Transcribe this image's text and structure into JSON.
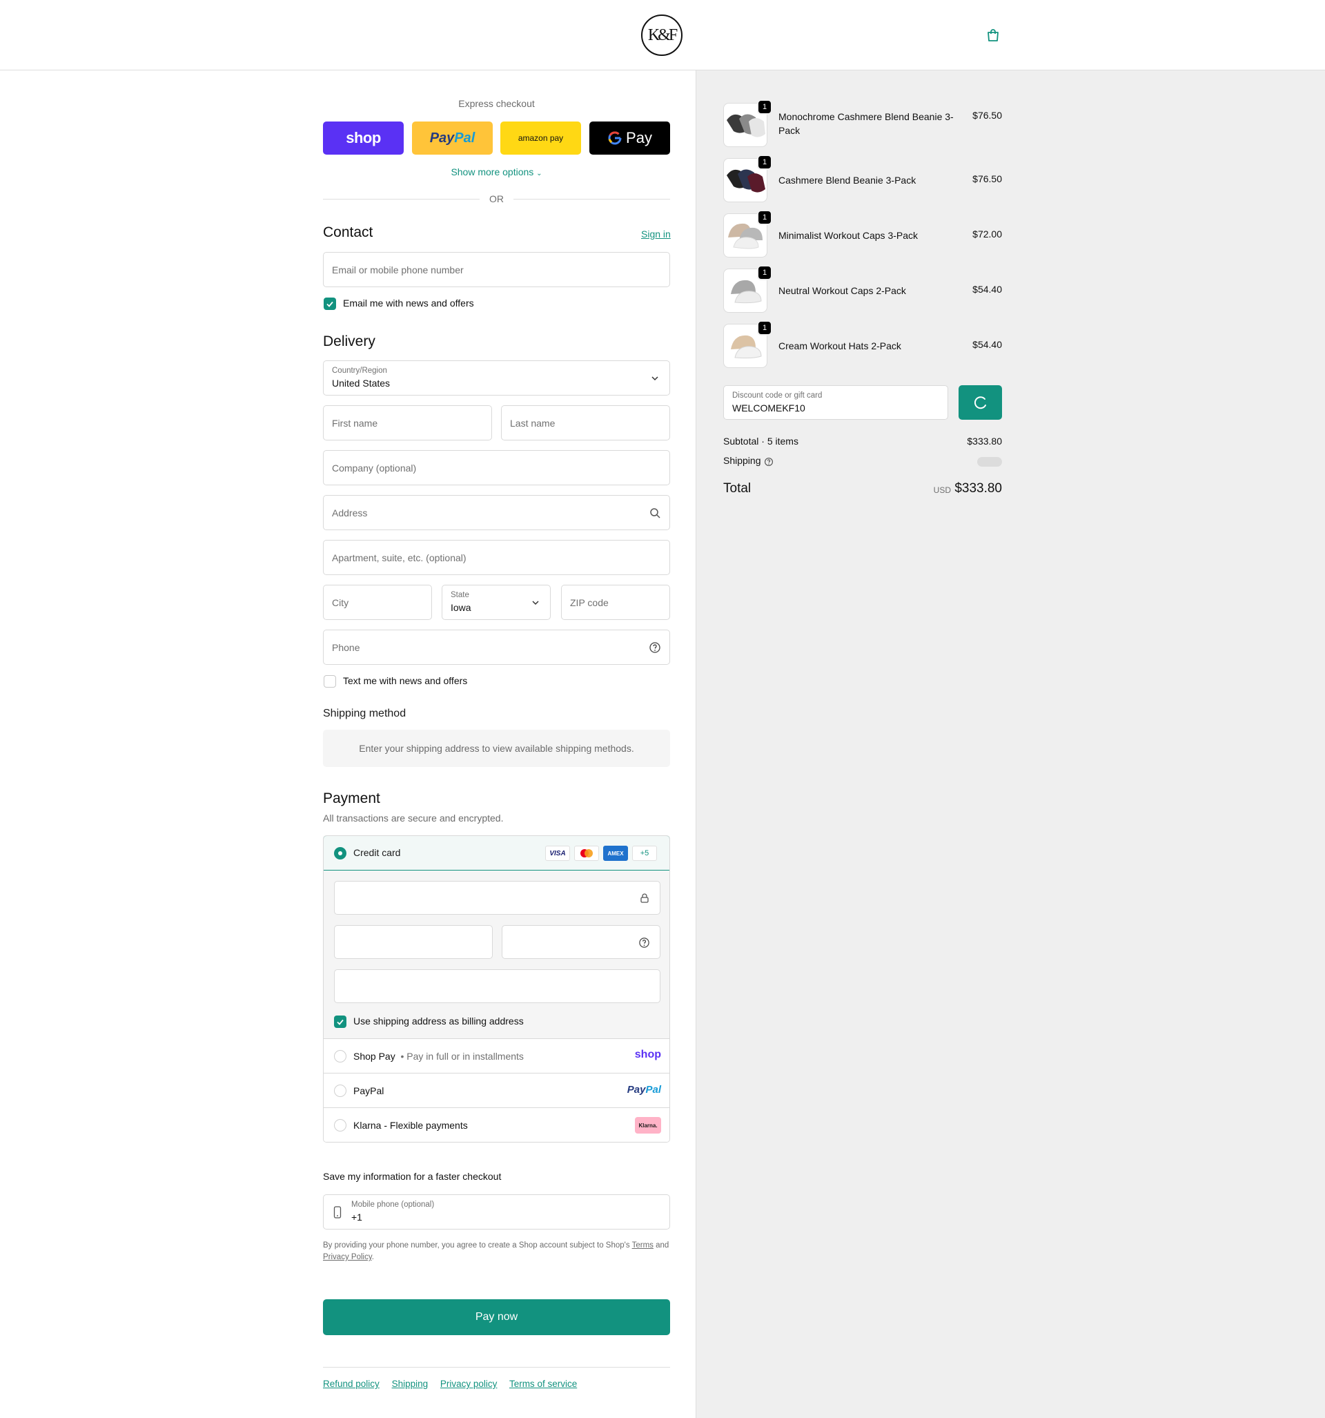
{
  "header": {
    "logo_text": "K&F"
  },
  "express": {
    "title": "Express checkout",
    "buttons": {
      "shop": "shop",
      "paypal_a": "Pay",
      "paypal_b": "Pal",
      "amazon": "amazon pay",
      "gpay": "Pay"
    },
    "show_more": "Show more options",
    "or": "OR"
  },
  "contact": {
    "title": "Contact",
    "sign_in": "Sign in",
    "email_placeholder": "Email or mobile phone number",
    "news_label": "Email me with news and offers"
  },
  "delivery": {
    "title": "Delivery",
    "country_label": "Country/Region",
    "country_value": "United States",
    "first_name": "First name",
    "last_name": "Last name",
    "company": "Company (optional)",
    "address": "Address",
    "apartment": "Apartment, suite, etc. (optional)",
    "city": "City",
    "state_label": "State",
    "state_value": "Iowa",
    "zip": "ZIP code",
    "phone": "Phone",
    "text_label": "Text me with news and offers"
  },
  "shipping_method": {
    "title": "Shipping method",
    "message": "Enter your shipping address to view available shipping methods."
  },
  "payment": {
    "title": "Payment",
    "subtitle": "All transactions are secure and encrypted.",
    "credit_card": "Credit card",
    "badges": {
      "visa": "VISA",
      "amex": "AMEX",
      "more": "+5"
    },
    "billing_label": "Use shipping address as billing address",
    "shop_pay": "Shop Pay",
    "shop_pay_sub": "Pay in full or in installments",
    "shop_pay_logo": "shop",
    "paypal": "PayPal",
    "paypal_logo_a": "Pay",
    "paypal_logo_b": "Pal",
    "klarna": "Klarna - Flexible payments",
    "klarna_logo": "Klarna."
  },
  "save_info": {
    "title": "Save my information for a faster checkout",
    "mobile_label": "Mobile phone (optional)",
    "mobile_value": "+1",
    "legal_1": "By providing your phone number, you agree to create a Shop account subject to Shop's",
    "terms": "Terms",
    "legal_and": "and",
    "privacy": "Privacy Policy",
    "legal_end": "."
  },
  "pay_now": "Pay now",
  "footer": {
    "refund": "Refund policy",
    "shipping": "Shipping",
    "privacy": "Privacy policy",
    "terms": "Terms of service"
  },
  "summary": {
    "items": [
      {
        "name": "Monochrome Cashmere Blend Beanie 3-Pack",
        "price": "$76.50",
        "qty": "1"
      },
      {
        "name": "Cashmere Blend Beanie 3-Pack",
        "price": "$76.50",
        "qty": "1"
      },
      {
        "name": "Minimalist Workout Caps 3-Pack",
        "price": "$72.00",
        "qty": "1"
      },
      {
        "name": "Neutral Workout Caps 2-Pack",
        "price": "$54.40",
        "qty": "1"
      },
      {
        "name": "Cream Workout Hats 2-Pack",
        "price": "$54.40",
        "qty": "1"
      }
    ],
    "discount_label": "Discount code or gift card",
    "discount_value": "WELCOMEKF10",
    "subtotal_label": "Subtotal · 5 items",
    "subtotal_value": "$333.80",
    "shipping_label": "Shipping",
    "total_label": "Total",
    "currency": "USD",
    "total_value": "$333.80"
  },
  "colors": {
    "accent": "#12927f",
    "shop": "#5a31f4",
    "paypal": "#ffc439",
    "amazon": "#ffd814"
  }
}
